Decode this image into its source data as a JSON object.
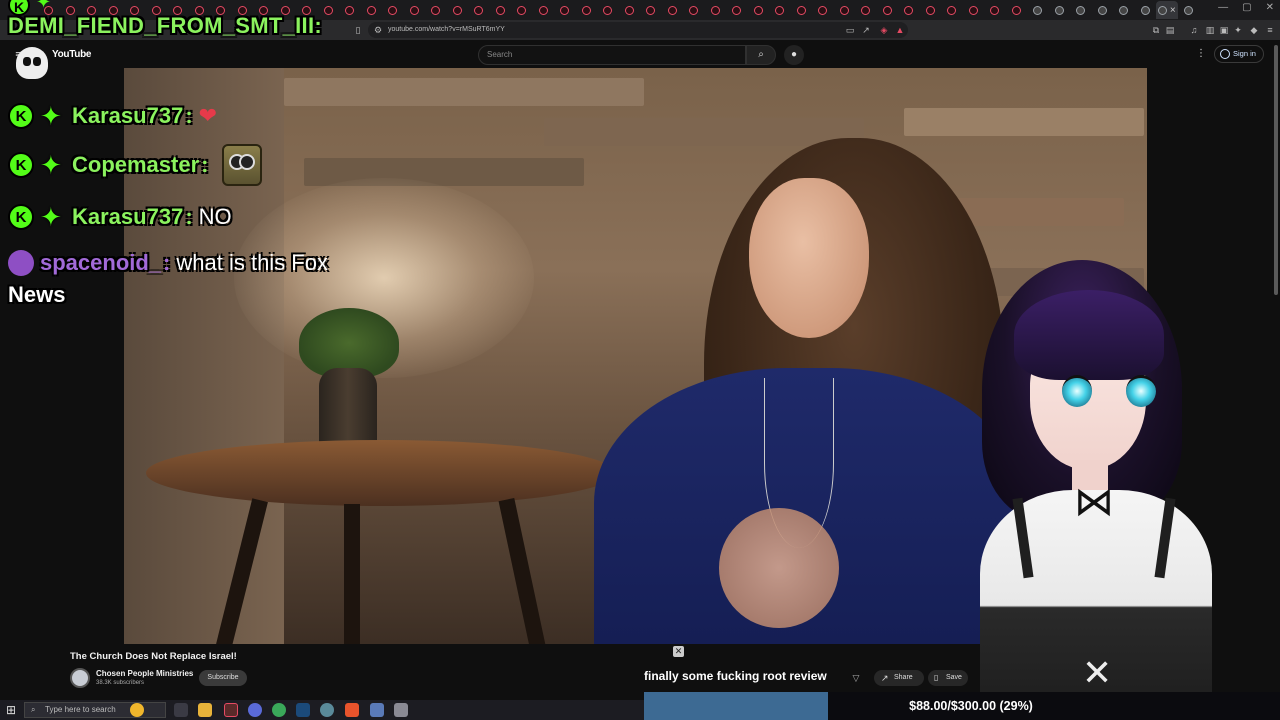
{
  "browser": {
    "url": "youtube.com/watch?v=rMSuRT6mYY",
    "tab_count": 54,
    "win_controls": [
      "—",
      "▢",
      "✕"
    ]
  },
  "youtube": {
    "logo_text": "YouTube",
    "search_placeholder": "Search",
    "signin_label": "Sign in"
  },
  "chat": {
    "header_user": "DEMI_FIEND_FROM_SMT_III:",
    "messages": [
      {
        "user": "Karasu737",
        "badges": [
          "K",
          "star"
        ],
        "message": "",
        "emote": "heart-emote"
      },
      {
        "user": "Copemaster",
        "badges": [
          "K",
          "star"
        ],
        "message": "",
        "emote": "owl-emote"
      },
      {
        "user": "Karasu737",
        "badges": [
          "K",
          "star"
        ],
        "message": "NO",
        "emote": ""
      },
      {
        "user": "spacenoid_",
        "badges": [
          "dot"
        ],
        "message": "what is this Fox",
        "emote": ""
      }
    ],
    "colon": ":",
    "news_label": "News"
  },
  "video": {
    "title": "The Church Does Not Replace Israel!",
    "channel": "Chosen People Ministries",
    "subscribers": "38.3K subscribers",
    "subscribe_label": "Subscribe",
    "share_label": "Share",
    "save_label": "Save",
    "caption": "finally some fucking root review"
  },
  "taskbar": {
    "search_placeholder": "Type here to search"
  },
  "donation_goal": {
    "text": "$88.00/$300.00 (29%)",
    "progress": 0.29
  },
  "colors": {
    "chat_green": "#8bf25e",
    "kick_green": "#53fc18",
    "chat_purple": "#a26ad8",
    "goal_fill": "#3d6a93"
  }
}
